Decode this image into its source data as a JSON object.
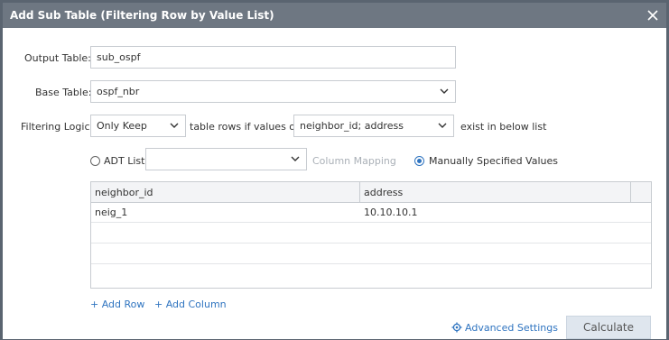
{
  "dialog": {
    "title": "Add Sub Table (Filtering Row by Value List)"
  },
  "form": {
    "output_table_label": "Output Table:",
    "output_table_value": "sub_ospf",
    "base_table_label": "Base Table:",
    "base_table_value": "ospf_nbr",
    "filtering_logic_label": "Filtering Logic:",
    "filtering_logic_value": "Only Keep",
    "middle_text": "table rows if values of",
    "columns_value": "neighbor_id; address",
    "end_text": "exist in below list"
  },
  "source": {
    "adt_list_label": "ADT List",
    "adt_list_value": "",
    "column_mapping_label": "Column Mapping",
    "manual_label": "Manually Specified Values",
    "selected": "manual"
  },
  "grid": {
    "headers": [
      "neighbor_id",
      "address"
    ],
    "rows": [
      [
        "neig_1",
        "10.10.10.1"
      ],
      [
        "",
        ""
      ],
      [
        "",
        ""
      ],
      [
        "",
        ""
      ]
    ]
  },
  "actions": {
    "add_row": "+ Add Row",
    "add_column": "+ Add Column",
    "advanced_settings": "Advanced Settings",
    "calculate": "Calculate"
  },
  "colors": {
    "title_bar": "#6e7782",
    "accent": "#2f74c0",
    "calculate_bg": "#dfe6ee"
  },
  "icons": {
    "close": "close-icon",
    "dropdown": "chevron-down-icon",
    "settings": "gear-icon"
  }
}
